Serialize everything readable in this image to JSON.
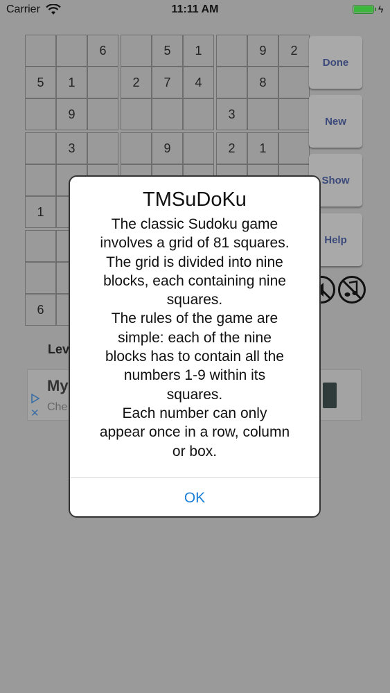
{
  "status_bar": {
    "carrier": "Carrier",
    "time": "11:11 AM"
  },
  "grid": {
    "rows": [
      [
        "",
        "",
        "6",
        "",
        "5",
        "1",
        "",
        "9",
        "2"
      ],
      [
        "5",
        "1",
        "",
        "2",
        "7",
        "4",
        "",
        "8",
        ""
      ],
      [
        "",
        "9",
        "",
        "",
        "",
        "",
        "3",
        "",
        ""
      ],
      [
        "",
        "3",
        "",
        "",
        "9",
        "",
        "2",
        "1",
        ""
      ],
      [
        "",
        "",
        "",
        "",
        "",
        "",
        "",
        "",
        ""
      ],
      [
        "1",
        "",
        "",
        "",
        "",
        "",
        "",
        "",
        ""
      ],
      [
        "",
        "",
        "",
        "",
        "",
        "",
        "",
        "",
        ""
      ],
      [
        "",
        "",
        "",
        "",
        "",
        "",
        "",
        "",
        ""
      ],
      [
        "6",
        "",
        "",
        "",
        "",
        "",
        "",
        "",
        ""
      ]
    ]
  },
  "buttons": {
    "done": "Done",
    "new": "New",
    "show": "Show",
    "help": "Help"
  },
  "sound_icons": [
    "sound-off-icon",
    "music-off-icon"
  ],
  "level": {
    "label": "Lev"
  },
  "ad": {
    "title": "My",
    "subtitle": "Che"
  },
  "alert": {
    "title": "TMSuDoKu",
    "message": "The classic Sudoku game\ninvolves a grid of 81 squares.\nThe grid is divided into nine\nblocks, each containing nine\nsquares.\nThe rules of the game are\nsimple: each of the nine\nblocks has to contain all the\nnumbers 1-9 within its\nsquares.\nEach number can only\nappear once in a row, column\nor box.",
    "ok": "OK"
  },
  "colors": {
    "overlay_bg": "#9a9a9a",
    "accent": "#1e7fd6",
    "button_text": "#3b4a7a",
    "battery": "#3bb73b"
  }
}
